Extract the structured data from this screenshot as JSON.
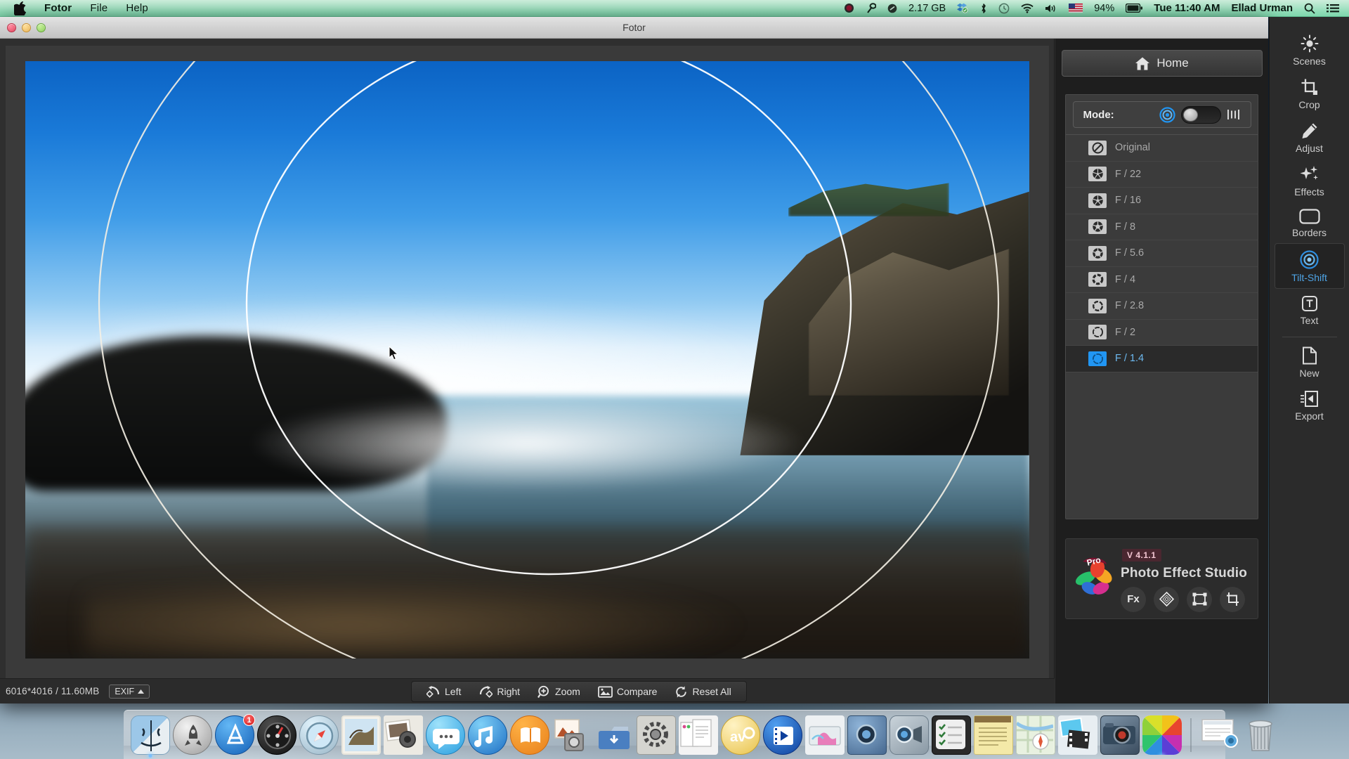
{
  "menubar": {
    "apple_icon": "apple-icon",
    "app_name": "Fotor",
    "menus": [
      "File",
      "Help"
    ],
    "status": {
      "record_icon": "record-dot-icon",
      "shortcut_icon": "magic-prefs-icon",
      "disk_icon": "disk-icon",
      "disk_free": "2.17 GB",
      "dropbox_icon": "dropbox-icon",
      "bluetooth_icon": "bluetooth-icon",
      "timemachine_icon": "time-machine-icon",
      "wifi_icon": "wifi-icon",
      "volume_icon": "volume-icon",
      "flag_icon": "us-flag-icon",
      "battery_percent": "94%",
      "battery_icon": "battery-icon",
      "clock": "Tue 11:40 AM",
      "user": "Ellad Urman",
      "spotlight_icon": "search-icon",
      "notification_icon": "notification-center-icon"
    }
  },
  "window": {
    "title": "Fotor",
    "traffic_lights": [
      "close",
      "minimize",
      "zoom"
    ]
  },
  "canvas": {
    "image_info": "6016*4016 / 11.60MB",
    "exif_label": "EXIF",
    "exif_caret": "caret-up-icon",
    "cursor": "mouse-pointer",
    "tools": [
      {
        "label": "Left",
        "icon": "rotate-left-icon"
      },
      {
        "label": "Right",
        "icon": "rotate-right-icon"
      },
      {
        "label": "Zoom",
        "icon": "zoom-in-icon"
      },
      {
        "label": "Compare",
        "icon": "compare-image-icon"
      },
      {
        "label": "Reset All",
        "icon": "reset-icon"
      }
    ]
  },
  "right_panel": {
    "home_label": "Home",
    "home_icon": "home-icon",
    "mode_label": "Mode:",
    "mode_circular_icon": "circular-tiltshift-icon",
    "mode_linear_icon": "linear-tiltshift-icon",
    "mode_selected": "circular",
    "apertures": [
      {
        "label": "Original",
        "icon": "no-aperture-icon",
        "selected": false
      },
      {
        "label": "F / 22",
        "icon": "aperture-22-icon",
        "selected": false
      },
      {
        "label": "F / 16",
        "icon": "aperture-16-icon",
        "selected": false
      },
      {
        "label": "F / 8",
        "icon": "aperture-8-icon",
        "selected": false
      },
      {
        "label": "F / 5.6",
        "icon": "aperture-56-icon",
        "selected": false
      },
      {
        "label": "F / 4",
        "icon": "aperture-4-icon",
        "selected": false
      },
      {
        "label": "F / 2.8",
        "icon": "aperture-28-icon",
        "selected": false
      },
      {
        "label": "F / 2",
        "icon": "aperture-2-icon",
        "selected": false
      },
      {
        "label": "F / 1.4",
        "icon": "aperture-14-icon",
        "selected": true
      }
    ],
    "studio": {
      "version": "V 4.1.1",
      "name": "Photo Effect Studio",
      "logo_icon": "fotor-pro-butterfly-icon",
      "buttons": [
        {
          "label": "Fx",
          "icon": "fx-icon"
        },
        {
          "label": "",
          "icon": "texture-diamond-icon"
        },
        {
          "label": "",
          "icon": "frame-icon"
        },
        {
          "label": "",
          "icon": "crop-icon"
        }
      ]
    }
  },
  "tool_rail": {
    "items": [
      {
        "label": "Scenes",
        "icon": "sun-scenes-icon",
        "active": false
      },
      {
        "label": "Crop",
        "icon": "crop-icon",
        "active": false
      },
      {
        "label": "Adjust",
        "icon": "pencil-icon",
        "active": false
      },
      {
        "label": "Effects",
        "icon": "sparkles-icon",
        "active": false
      },
      {
        "label": "Borders",
        "icon": "border-icon",
        "active": false
      },
      {
        "label": "Tilt-Shift",
        "icon": "tilt-shift-icon",
        "active": true
      },
      {
        "label": "Text",
        "icon": "text-t-icon",
        "active": false
      }
    ],
    "footer_items": [
      {
        "label": "New",
        "icon": "new-document-icon"
      },
      {
        "label": "Export",
        "icon": "export-icon"
      }
    ]
  },
  "dock": {
    "items": [
      {
        "name": "finder",
        "badge": "",
        "running": true
      },
      {
        "name": "launchpad",
        "badge": "",
        "running": false
      },
      {
        "name": "app-store",
        "badge": "1",
        "running": false
      },
      {
        "name": "dashboard",
        "badge": "",
        "running": false
      },
      {
        "name": "safari",
        "badge": "",
        "running": false
      },
      {
        "name": "mail",
        "badge": "",
        "running": false
      },
      {
        "name": "iphoto",
        "badge": "",
        "running": false
      },
      {
        "name": "messages",
        "badge": "",
        "running": false
      },
      {
        "name": "itunes",
        "badge": "",
        "running": false
      },
      {
        "name": "ibooks",
        "badge": "",
        "running": false
      },
      {
        "name": "preview",
        "badge": "",
        "running": false
      },
      {
        "name": "downloads-folder",
        "badge": "",
        "running": false
      },
      {
        "name": "system-preferences",
        "badge": "",
        "running": false
      },
      {
        "name": "pages",
        "badge": "",
        "running": false
      },
      {
        "name": "avc-converter",
        "badge": "",
        "running": false
      },
      {
        "name": "video-player",
        "badge": "",
        "running": false
      },
      {
        "name": "keynote",
        "badge": "",
        "running": false
      },
      {
        "name": "photo-booth",
        "badge": "",
        "running": false
      },
      {
        "name": "facetime",
        "badge": "",
        "running": false
      },
      {
        "name": "reminders",
        "badge": "",
        "running": false
      },
      {
        "name": "notes",
        "badge": "",
        "running": false
      },
      {
        "name": "maps",
        "badge": "",
        "running": false
      },
      {
        "name": "imovie",
        "badge": "",
        "running": false
      },
      {
        "name": "camera-app",
        "badge": "",
        "running": false
      },
      {
        "name": "fotor",
        "badge": "",
        "running": true
      },
      {
        "name": "stacks-documents",
        "badge": "",
        "running": false
      },
      {
        "name": "trash",
        "badge": "",
        "running": false
      }
    ]
  },
  "colors": {
    "accent_blue": "#2196f3",
    "menubar_green": "#a9e3c6",
    "panel_dark": "#2b2b2b",
    "list_bg": "#3b3b3b"
  }
}
